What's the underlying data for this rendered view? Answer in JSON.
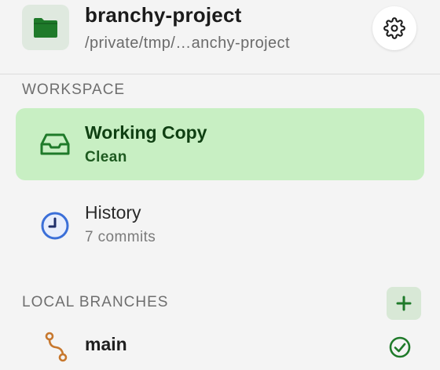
{
  "header": {
    "project_name": "branchy-project",
    "project_path": "/private/tmp/…anchy-project",
    "folder_icon": "folder-icon",
    "settings_icon": "gear-icon"
  },
  "workspace": {
    "section_label": "WORKSPACE",
    "items": [
      {
        "title": "Working Copy",
        "subtitle": "Clean",
        "icon": "inbox-tray-icon",
        "selected": true
      },
      {
        "title": "History",
        "subtitle": "7 commits",
        "icon": "clock-icon",
        "selected": false
      }
    ]
  },
  "local_branches": {
    "section_label": "LOCAL BRANCHES",
    "add_icon": "plus-icon",
    "branches": [
      {
        "name": "main",
        "icon": "branch-icon",
        "status_icon": "check-circle-icon",
        "current": true
      }
    ]
  },
  "colors": {
    "accent_green": "#1f7a2a",
    "selected_background": "#c8efc3",
    "clock_blue": "#3b6fd8",
    "branch_orange": "#c7782e"
  }
}
